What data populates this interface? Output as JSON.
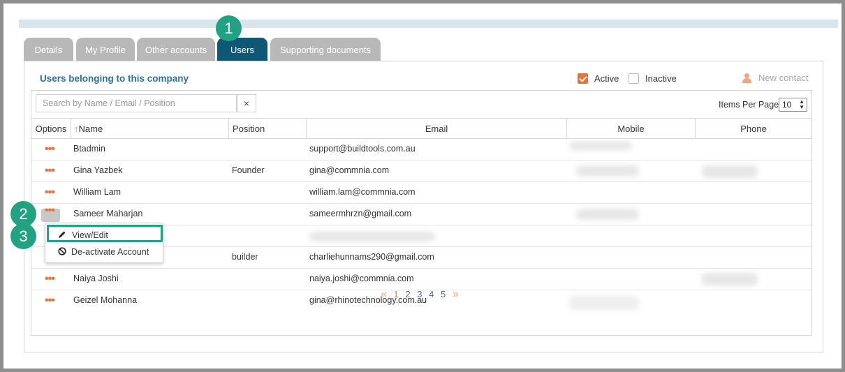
{
  "tabs": [
    {
      "label": "Details"
    },
    {
      "label": "My Profile"
    },
    {
      "label": "Other accounts"
    },
    {
      "label": "Users",
      "active": true
    },
    {
      "label": "Supporting documents"
    }
  ],
  "panel": {
    "title": "Users belonging to this company",
    "active_label": "Active",
    "active_checked": true,
    "inactive_label": "Inactive",
    "inactive_checked": false,
    "new_contact_label": "New contact"
  },
  "search": {
    "placeholder": "Search by Name / Email / Position",
    "clear": "×"
  },
  "items_per_page": {
    "label": "Items Per Page",
    "value": "10"
  },
  "table": {
    "columns": [
      "Options",
      "↑Name",
      "Position",
      "Email",
      "Mobile",
      "Phone"
    ],
    "rows": [
      {
        "name": "Btadmin",
        "position": "",
        "email": "support@buildtools.com.au"
      },
      {
        "name": "Gina Yazbek",
        "position": "Founder",
        "email": "gina@commnia.com"
      },
      {
        "name": "William Lam",
        "position": "",
        "email": "william.lam@commnia.com"
      },
      {
        "name": "Sameer Maharjan",
        "position": "",
        "email": "sameermhrzn@gmail.com"
      },
      {
        "name": "",
        "position": "",
        "email": ""
      },
      {
        "name": "",
        "position": "builder",
        "email": "charliehunnams290@gmail.com"
      },
      {
        "name": "Naiya Joshi",
        "position": "",
        "email": "naiya.joshi@commnia.com"
      },
      {
        "name": "Geizel Mohanna",
        "position": "",
        "email": "gina@rhinotechnology.com.au"
      }
    ],
    "options_icon": "•••"
  },
  "pagination": {
    "prev": "«",
    "pages": [
      "1",
      "2",
      "3",
      "4",
      "5"
    ],
    "current": "1",
    "next": "»"
  },
  "context_menu": {
    "view_edit": "View/Edit",
    "deactivate": "De-activate Account"
  },
  "badges": [
    "1",
    "2",
    "3"
  ],
  "colors": {
    "accent": "#ea7236",
    "tab_active": "#0e5876",
    "badge": "#21a283",
    "title": "#2d6fa5"
  }
}
